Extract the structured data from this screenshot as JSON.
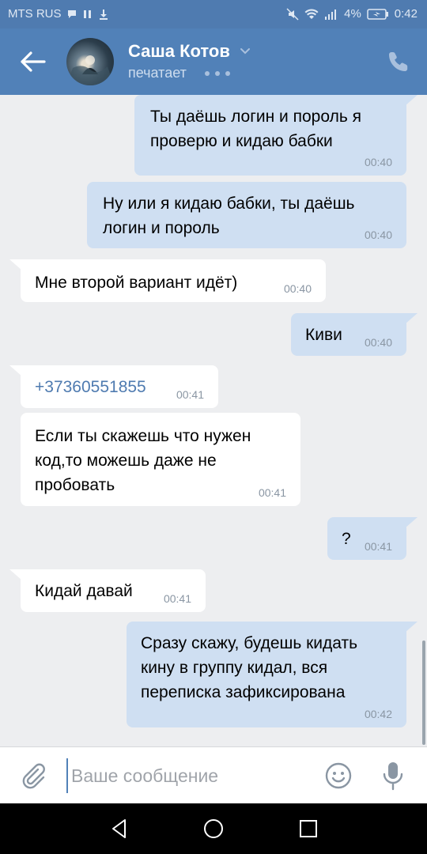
{
  "status_bar": {
    "carrier": "MTS RUS",
    "battery": "4%",
    "time": "0:42"
  },
  "header": {
    "name": "Саша Котов",
    "status": "печатает"
  },
  "messages": [
    {
      "dir": "out",
      "text": "Ты даёшь логин и пороль я\nпроверю и кидаю бабки",
      "time": "00:40"
    },
    {
      "dir": "out",
      "text": "Ну или я кидаю бабки, ты даёшь\nлогин и пороль",
      "time": "00:40"
    },
    {
      "dir": "in",
      "text": "Мне второй вариант идёт)",
      "time": "00:40"
    },
    {
      "dir": "out",
      "text": "Киви",
      "time": "00:40"
    },
    {
      "dir": "in",
      "text": "+37360551855",
      "time": "00:41"
    },
    {
      "dir": "in",
      "text": "Если ты скажешь что нужен\nкод,то можешь даже не\nпробовать",
      "time": "00:41"
    },
    {
      "dir": "out",
      "text": "?",
      "time": "00:41"
    },
    {
      "dir": "in",
      "text": "Кидай давай",
      "time": "00:41"
    },
    {
      "dir": "out",
      "text": "Сразу скажу, будешь кидать\nкину в группу кидал, вся\nпереписка зафиксирована",
      "time": "00:42"
    }
  ],
  "input": {
    "placeholder": "Ваше сообщение",
    "value": ""
  },
  "icons": {
    "back": "arrow-left-icon",
    "call": "phone-icon",
    "attach": "paperclip-icon",
    "emoji": "smiley-icon",
    "mic": "microphone-icon"
  },
  "colors": {
    "header": "#5181b8",
    "outgoing_bubble": "#cfdff2",
    "incoming_bubble": "#ffffff",
    "background": "#edeef0"
  }
}
